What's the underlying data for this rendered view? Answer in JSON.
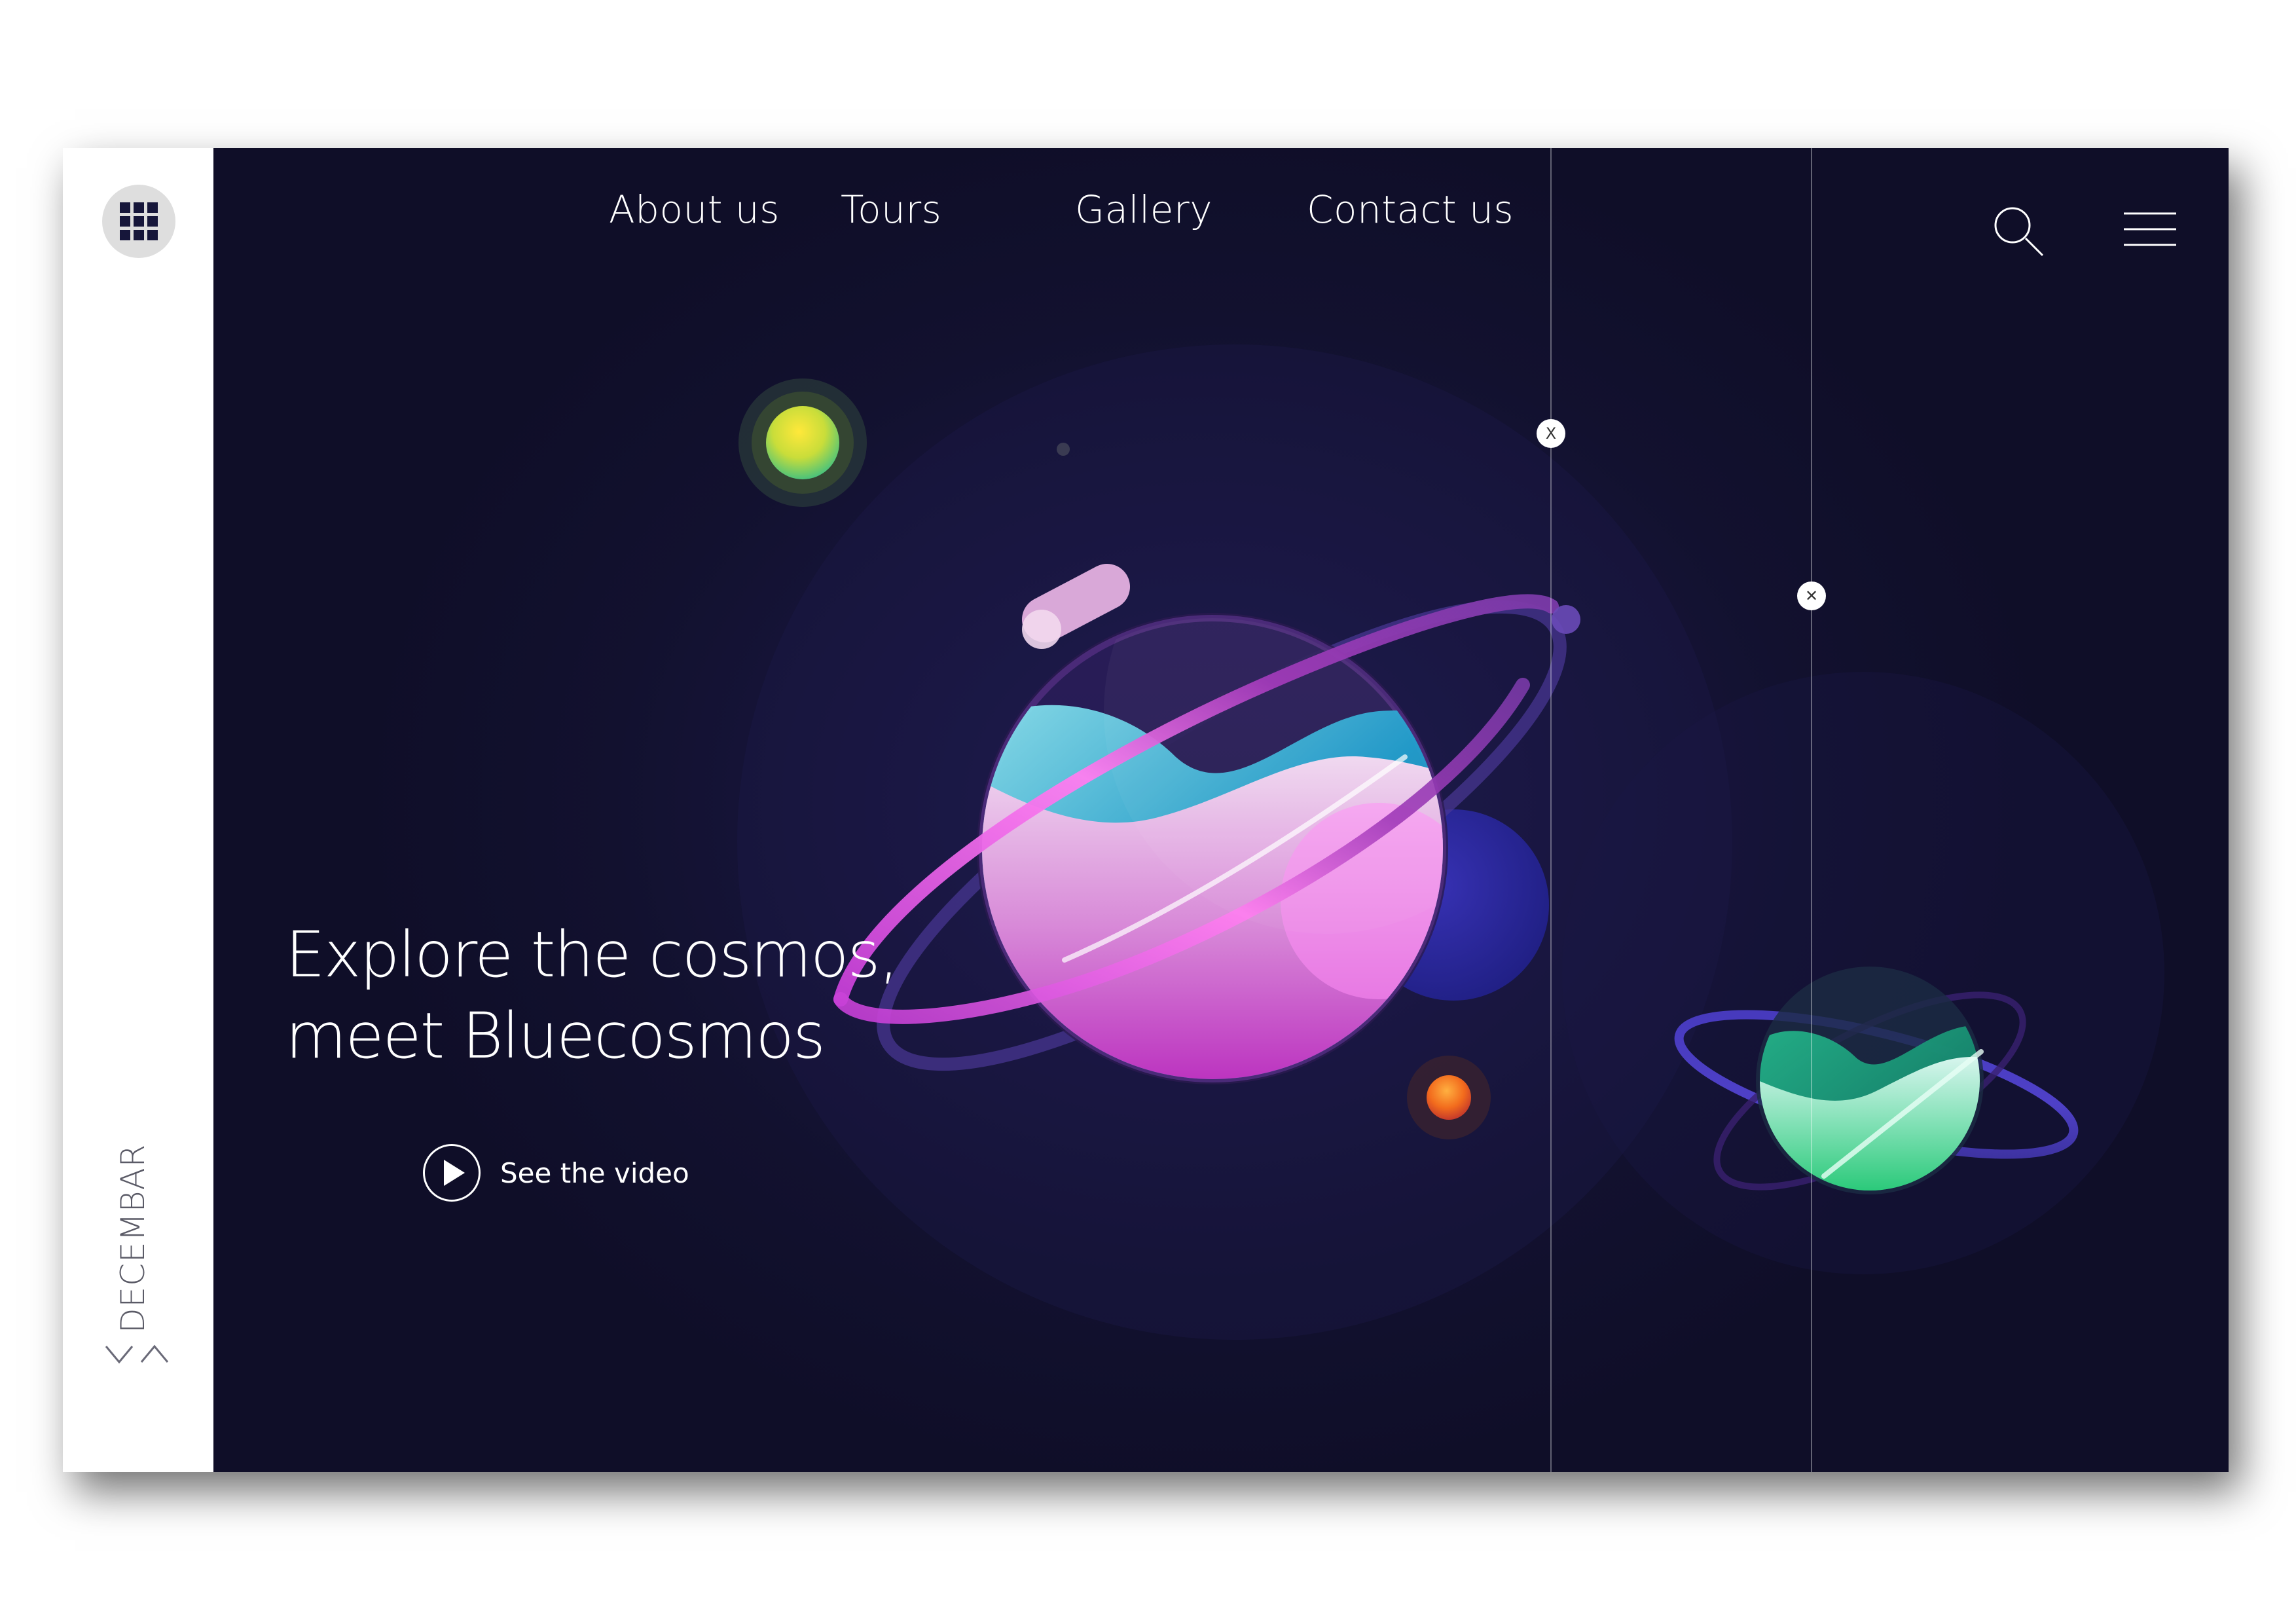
{
  "sidebar": {
    "month_label": "DECEMBAR",
    "icons": [
      "apps-grid-icon",
      "chevron-down-icon",
      "chevron-up-icon"
    ]
  },
  "nav": {
    "items": [
      {
        "label": "About us"
      },
      {
        "label": "Tours"
      },
      {
        "label": "Gallery"
      },
      {
        "label": "Contact us"
      }
    ],
    "icons": [
      "search-icon",
      "hamburger-menu-icon"
    ]
  },
  "hero": {
    "headline_line1": "Explore the cosmos,",
    "headline_line2": "meet Bluecosmos",
    "video_label": "See the video"
  },
  "markers": [
    {
      "symbol": "X"
    },
    {
      "symbol": "✕"
    }
  ],
  "colors": {
    "background": "#12112f",
    "sidebar": "#ffffff",
    "planet_main": "#c13fd0",
    "planet_water": "#1aa0c8",
    "planet_green": "#1fc77a",
    "sun_yellow": "#d9e23a",
    "sun_orange": "#f26b1d"
  }
}
